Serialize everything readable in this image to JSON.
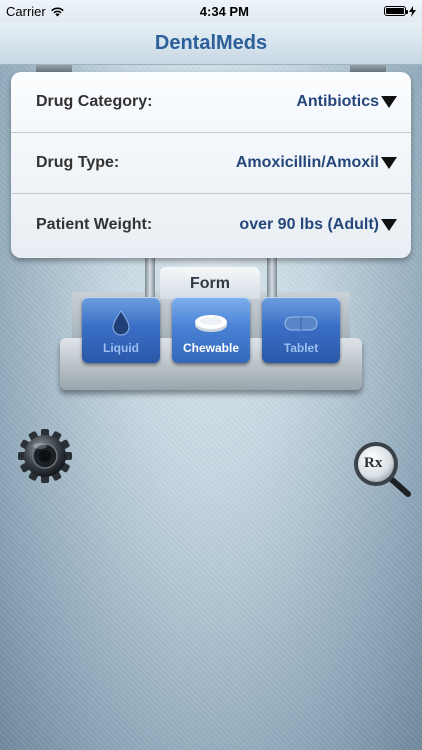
{
  "status_bar": {
    "carrier": "Carrier",
    "time": "4:34 PM"
  },
  "nav": {
    "title": "DentalMeds"
  },
  "settings": {
    "rows": [
      {
        "label": "Drug Category:",
        "value": "Antibiotics"
      },
      {
        "label": "Drug Type:",
        "value": "Amoxicillin/Amoxil"
      },
      {
        "label": "Patient Weight:",
        "value": "over 90 lbs (Adult)"
      }
    ]
  },
  "form": {
    "tab_label": "Form",
    "options": [
      {
        "label": "Liquid",
        "icon": "droplet-icon"
      },
      {
        "label": "Chewable",
        "icon": "chewable-pill-icon",
        "selected": true
      },
      {
        "label": "Tablet",
        "icon": "tablet-pill-icon"
      }
    ]
  },
  "controls": {
    "rx_label": "Rx",
    "settings_icon": "gear-icon",
    "rx_icon": "magnifier-icon"
  },
  "colors": {
    "nav_title": "#2d5f9a",
    "value_text": "#24467a",
    "button_blue": "#3a6fc6"
  }
}
